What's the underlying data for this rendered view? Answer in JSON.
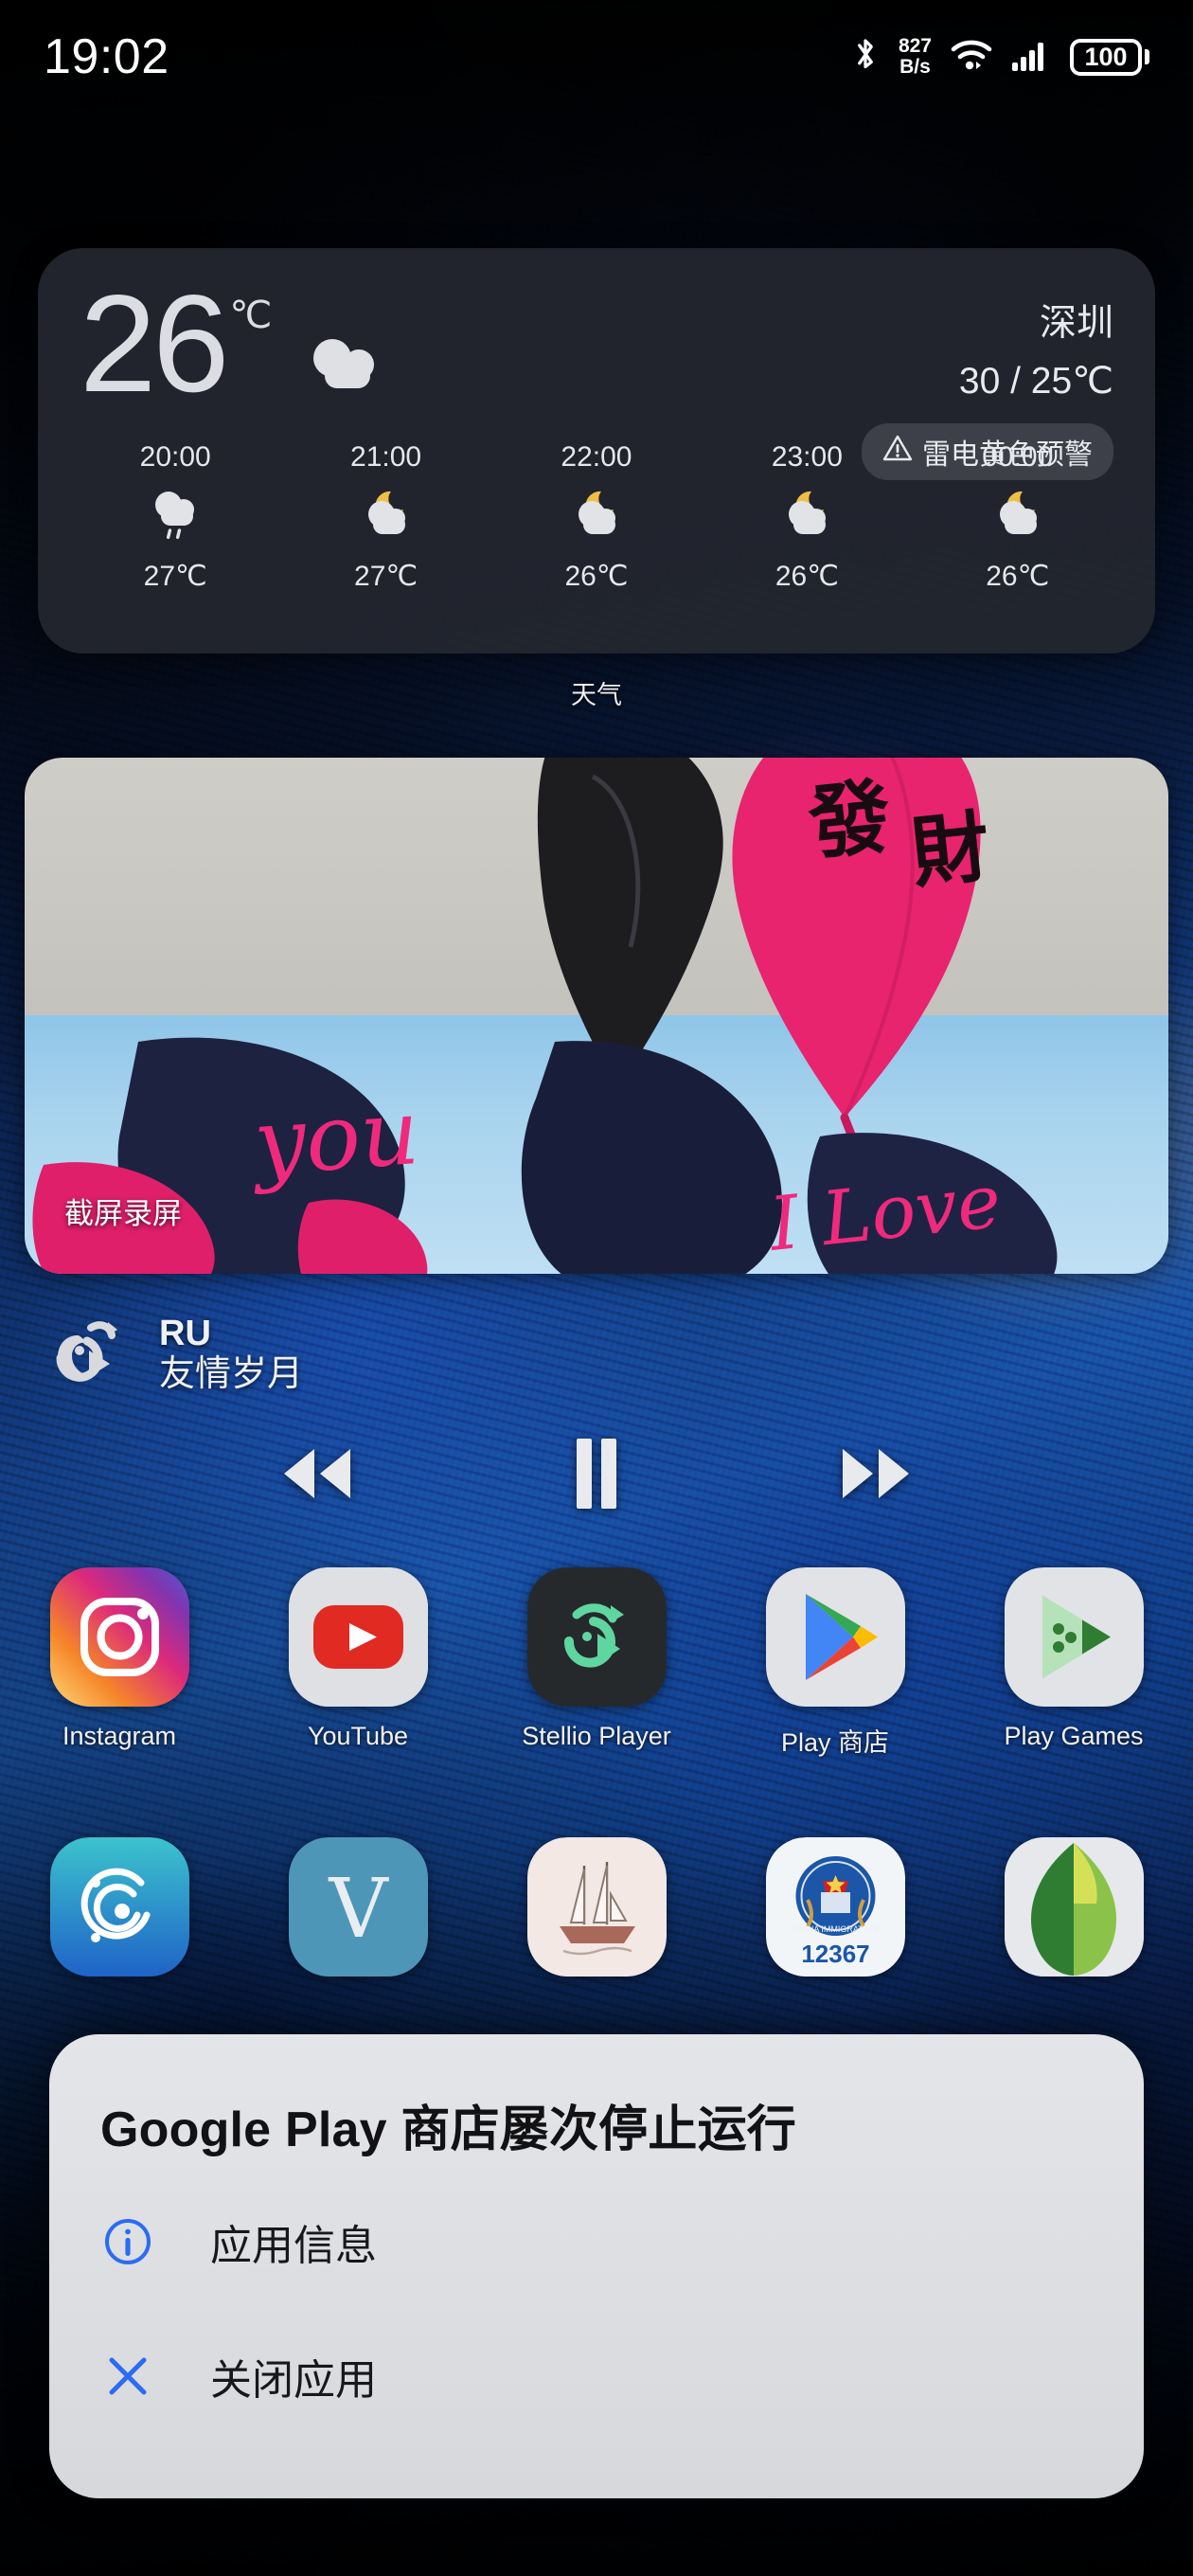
{
  "statusbar": {
    "clock": "19:02",
    "bluetooth_icon": "bluetooth-icon",
    "net_speed_value": "827",
    "net_speed_unit": "B/s",
    "wifi_icon": "wifi-icon",
    "signal_icon": "cellular-signal-icon",
    "battery_level": "100"
  },
  "weather": {
    "widget_label": "天气",
    "temperature": "26",
    "unit": "℃",
    "condition_icon": "cloudy-icon",
    "city": "深圳",
    "range": "30 / 25℃",
    "alert_icon": "warning-triangle-icon",
    "alert_text": "雷电黄色预警",
    "hours": [
      {
        "time": "20:00",
        "icon": "rain-icon",
        "temp": "27℃"
      },
      {
        "time": "21:00",
        "icon": "night-cloud-icon",
        "temp": "27℃"
      },
      {
        "time": "22:00",
        "icon": "night-cloud-icon",
        "temp": "26℃"
      },
      {
        "time": "23:00",
        "icon": "night-cloud-icon",
        "temp": "26℃"
      },
      {
        "time": "00:00",
        "icon": "night-cloud-icon",
        "temp": "26℃"
      }
    ]
  },
  "screenshot_widget": {
    "label": "截屏录屏",
    "balloon_text_top": "發財",
    "balloon_text_mid": "you",
    "balloon_text_bottom": "I Love"
  },
  "music": {
    "app_icon": "stellio-player-icon",
    "artist": "RU",
    "title": "友情岁月",
    "prev_icon": "rewind-icon",
    "play_state_icon": "pause-icon",
    "next_icon": "fast-forward-icon"
  },
  "apps": {
    "row1": [
      {
        "name": "instagram",
        "label": "Instagram",
        "icon": "instagram-icon"
      },
      {
        "name": "youtube",
        "label": "YouTube",
        "icon": "youtube-icon"
      },
      {
        "name": "stellio",
        "label": "Stellio Player",
        "icon": "stellio-player-icon"
      },
      {
        "name": "play-store",
        "label": "Play 商店",
        "icon": "google-play-icon"
      },
      {
        "name": "play-games",
        "label": "Play Games",
        "icon": "play-games-icon"
      }
    ],
    "row2": [
      {
        "name": "sonar-app",
        "label": "",
        "icon": "sonar-circles-icon"
      },
      {
        "name": "v-app",
        "label": "",
        "icon": "letter-v-icon"
      },
      {
        "name": "sailboat-app",
        "label": "",
        "icon": "sailboat-icon"
      },
      {
        "name": "immigration",
        "label": "",
        "icon": "china-immigration-icon",
        "badge": "12367"
      },
      {
        "name": "snapseed",
        "label": "",
        "icon": "snapseed-leaf-icon"
      }
    ]
  },
  "dialog": {
    "title": "Google Play 商店屡次停止运行",
    "items": [
      {
        "name": "app-info",
        "icon": "info-circle-icon",
        "label": "应用信息"
      },
      {
        "name": "close-app",
        "icon": "close-x-icon",
        "label": "关闭应用"
      }
    ]
  },
  "colors": {
    "accent_blue": "#2b6cf0",
    "widget_bg": "#24272f",
    "dialog_bg": "#e0e2e6",
    "alert_yellow": "#e8b93a"
  }
}
